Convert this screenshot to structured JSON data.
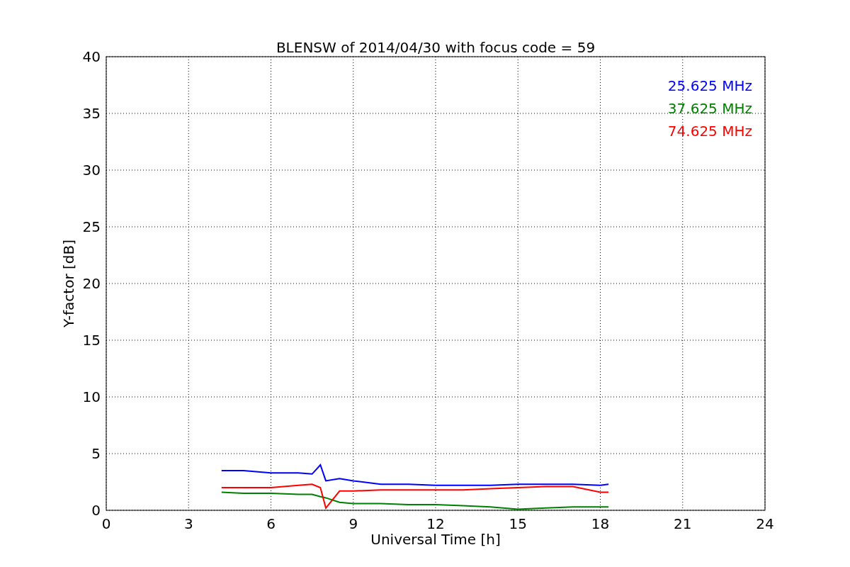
{
  "chart_data": {
    "type": "line",
    "title": "BLENSW of 2014/04/30 with focus code = 59",
    "xlabel": "Universal Time [h]",
    "ylabel": "Y-factor [dB]",
    "x": [
      4.2,
      5,
      6,
      7,
      7.5,
      7.8,
      8,
      8.5,
      9,
      10,
      11,
      12,
      13,
      14,
      15,
      16,
      17,
      18,
      18.3
    ],
    "series": [
      {
        "name": "25.625 MHz",
        "color": "#0000ff",
        "values": [
          3.5,
          3.5,
          3.3,
          3.3,
          3.2,
          4.0,
          2.6,
          2.8,
          2.6,
          2.3,
          2.3,
          2.2,
          2.2,
          2.2,
          2.3,
          2.3,
          2.3,
          2.2,
          2.3
        ]
      },
      {
        "name": "37.625 MHz",
        "color": "#008000",
        "values": [
          1.6,
          1.5,
          1.5,
          1.4,
          1.4,
          1.2,
          1.1,
          0.7,
          0.6,
          0.6,
          0.5,
          0.5,
          0.4,
          0.3,
          0.1,
          0.2,
          0.3,
          0.3,
          0.3
        ]
      },
      {
        "name": "74.625 MHz",
        "color": "#ff0000",
        "values": [
          2.0,
          2.0,
          2.0,
          2.2,
          2.3,
          2.0,
          0.2,
          1.7,
          1.7,
          1.8,
          1.8,
          1.8,
          1.8,
          1.9,
          2.0,
          2.1,
          2.1,
          1.6,
          1.6
        ]
      }
    ],
    "xlim": [
      0,
      24
    ],
    "ylim": [
      0,
      40
    ],
    "xticks": [
      0,
      3,
      6,
      9,
      12,
      15,
      18,
      21,
      24
    ],
    "yticks": [
      0,
      5,
      10,
      15,
      20,
      25,
      30,
      35,
      40
    ],
    "grid": true
  }
}
